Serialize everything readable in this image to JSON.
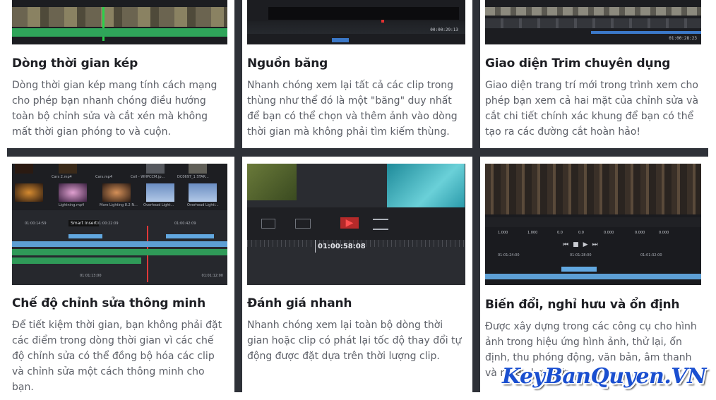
{
  "features": [
    {
      "title": "Dòng thời gian kép",
      "description": "Dòng thời gian kép mang tính cách mạng cho phép bạn nhanh chóng điều hướng toàn bộ chỉnh sửa và cắt xén mà không mất thời gian phóng to và cuộn."
    },
    {
      "title": "Nguồn băng",
      "description": "Nhanh chóng xem lại tất cả các clip trong thùng như thể đó là một \"băng\" duy nhất để bạn có thể chọn và thêm ảnh vào dòng thời gian mà không phải tìm kiếm thùng.",
      "timecode": "00:00:29:13"
    },
    {
      "title": "Giao diện Trim chuyên dụng",
      "description": "Giao diện trang trí mới trong trình xem cho phép bạn xem cả hai mặt của chỉnh sửa và cắt chi tiết chính xác khung để bạn có thể tạo ra các đường cắt hoàn hảo!",
      "timecode": "01:00:28:23"
    },
    {
      "title": "Chế độ chỉnh sửa thông minh",
      "description": "Để tiết kiệm thời gian, bạn không phải đặt các điểm trong dòng thời gian vì các chế độ chỉnh sửa có thể đồng bộ hóa các clip và chỉnh sửa một cách thông minh cho bạn.",
      "clips": [
        "Cars 2.mp4",
        "Cars.mp4",
        "Cell - WHPCCM.jp...",
        "DC0697_1 STAR...",
        "Lightning.mp4",
        "More Lighting 8.2 N...",
        "Overhead Light...",
        "Overhead Lighti..."
      ],
      "tooltip": "Smart Insert",
      "ruler": [
        "01:00:14:59",
        "01:00:22:09",
        "01:00:42:09"
      ],
      "bottom_times": [
        "01:01:13:00",
        "01:01:12:00"
      ]
    },
    {
      "title": "Đánh giá nhanh",
      "description": "Nhanh chóng xem lại toàn bộ dòng thời gian hoặc clip có phát lại tốc độ thay đổi tự động được đặt dựa trên thời lượng clip.",
      "timecode": "01:00:58:08"
    },
    {
      "title": "Biến đổi, nghỉ hưu và ổn định",
      "description": "Được xây dựng trong các công cụ cho hình ảnh trong hiệu ứng hình ảnh, thử lại, ổn định, thu phóng động, văn bản, âm thanh và nhiều hơn nữa.",
      "params": [
        "1.000",
        "1.000",
        "0.0",
        "0.0",
        "0.000",
        "0.000",
        "0.000"
      ],
      "ruler": [
        "01:01:24:00",
        "01:01:28:00",
        "01:01:32:00"
      ]
    }
  ],
  "watermark": "KeyBanQuyen.VN"
}
